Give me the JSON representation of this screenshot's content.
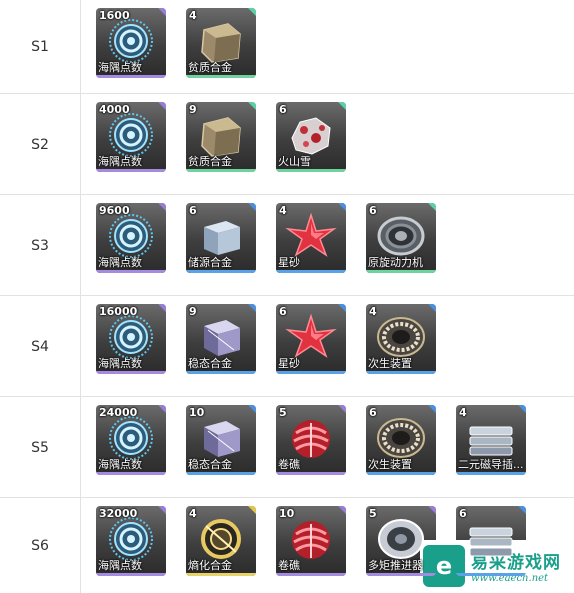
{
  "colors": {
    "bar_purple": "#a58be0",
    "bar_green": "#6fd3a0",
    "bar_blue": "#5aa2e8",
    "bar_yellow": "#e8d26a",
    "corner_purple": "#9a7bd6",
    "corner_green": "#5bd1a4",
    "corner_blue": "#4a8fe0",
    "corner_yellow": "#e2c44c"
  },
  "rows": [
    {
      "stage": "S1",
      "items": [
        {
          "count": "1600",
          "name": "海隅点数",
          "icon": "coin-icon",
          "rarity": "purple"
        },
        {
          "count": "4",
          "name": "贫质合金",
          "icon": "ore-block-icon",
          "rarity": "green"
        }
      ]
    },
    {
      "stage": "S2",
      "items": [
        {
          "count": "4000",
          "name": "海隅点数",
          "icon": "coin-icon",
          "rarity": "purple"
        },
        {
          "count": "9",
          "name": "贫质合金",
          "icon": "ore-block-icon",
          "rarity": "green"
        },
        {
          "count": "6",
          "name": "火山雪",
          "icon": "volcanic-rock-icon",
          "rarity": "green"
        }
      ]
    },
    {
      "stage": "S3",
      "items": [
        {
          "count": "9600",
          "name": "海隅点数",
          "icon": "coin-icon",
          "rarity": "purple"
        },
        {
          "count": "6",
          "name": "储源合金",
          "icon": "metal-cube-icon",
          "rarity": "blue"
        },
        {
          "count": "4",
          "name": "星砂",
          "icon": "star-shard-icon",
          "rarity": "blue"
        },
        {
          "count": "6",
          "name": "原旋动力机",
          "icon": "engine-ring-icon",
          "rarity": "green"
        }
      ]
    },
    {
      "stage": "S4",
      "items": [
        {
          "count": "16000",
          "name": "海隅点数",
          "icon": "coin-icon",
          "rarity": "purple"
        },
        {
          "count": "9",
          "name": "稳态合金",
          "icon": "crystal-cube-icon",
          "rarity": "blue"
        },
        {
          "count": "6",
          "name": "星砂",
          "icon": "star-shard-icon",
          "rarity": "blue"
        },
        {
          "count": "4",
          "name": "次生装置",
          "icon": "bearing-ring-icon",
          "rarity": "blue"
        }
      ]
    },
    {
      "stage": "S5",
      "items": [
        {
          "count": "24000",
          "name": "海隅点数",
          "icon": "coin-icon",
          "rarity": "purple"
        },
        {
          "count": "10",
          "name": "稳态合金",
          "icon": "crystal-cube-icon",
          "rarity": "blue"
        },
        {
          "count": "5",
          "name": "卷礁",
          "icon": "coral-icon",
          "rarity": "purple"
        },
        {
          "count": "6",
          "name": "次生装置",
          "icon": "bearing-ring-icon",
          "rarity": "blue"
        },
        {
          "count": "4",
          "name": "二元磁导插...",
          "icon": "magnet-bars-icon",
          "rarity": "blue"
        }
      ]
    },
    {
      "stage": "S6",
      "items": [
        {
          "count": "32000",
          "name": "海隅点数",
          "icon": "coin-icon",
          "rarity": "purple"
        },
        {
          "count": "4",
          "name": "熵化合金",
          "icon": "gold-alloy-icon",
          "rarity": "yellow"
        },
        {
          "count": "10",
          "name": "卷礁",
          "icon": "coral-icon",
          "rarity": "purple"
        },
        {
          "count": "5",
          "name": "多矩推进器",
          "icon": "thruster-ring-icon",
          "rarity": "purple"
        },
        {
          "count": "6",
          "name": "",
          "icon": "magnet-bars-icon",
          "rarity": "blue"
        }
      ]
    }
  ],
  "watermark": {
    "logo_letter": "e",
    "name": "易采游戏网",
    "url": "www.eaech.net"
  }
}
